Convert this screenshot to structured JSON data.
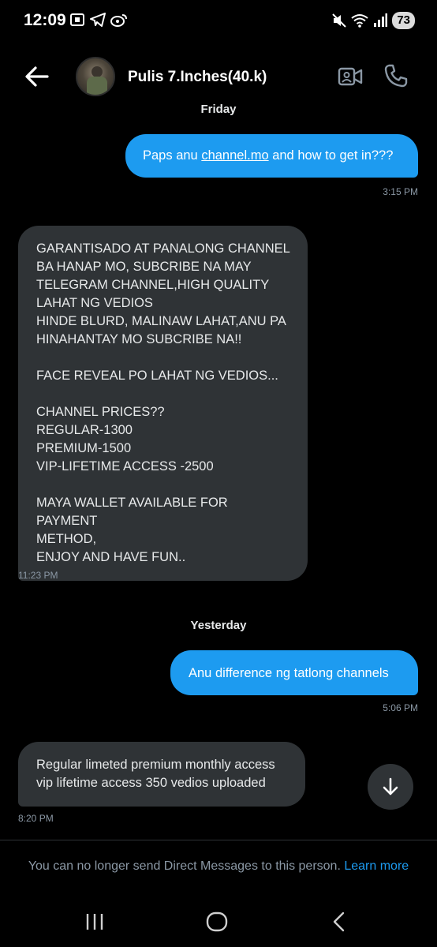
{
  "status_bar": {
    "time": "12:09",
    "battery": "73"
  },
  "header": {
    "contact_name": "Pulis 7.Inches(40.k)"
  },
  "chat": {
    "partial_date": "Friday",
    "msg1": {
      "before": "Paps anu ",
      "link": "channel.mo",
      "after": " and how to get in???",
      "time": "3:15 PM"
    },
    "msg2": {
      "text": "GARANTISADO AT PANALONG CHANNEL\nBA HANAP MO, SUBCRIBE NA MAY\nTELEGRAM CHANNEL,HIGH QUALITY\nLAHAT NG VEDIOS\nHINDE BLURD, MALINAW LAHAT,ANU PA\nHINAHANTAY MO SUBCRIBE NA!!\n\nFACE REVEAL PO LAHAT NG VEDIOS...\n\nCHANNEL PRICES??\nREGULAR-1300\nPREMIUM-1500\nVIP-LIFETIME ACCESS -2500\n\nMAYA WALLET AVAILABLE FOR PAYMENT\nMETHOD,\nENJOY AND HAVE FUN..",
      "time": "11:23 PM"
    },
    "date_yesterday": "Yesterday",
    "msg3": {
      "text": "Anu difference ng tatlong channels",
      "time": "5:06 PM"
    },
    "msg4": {
      "text": "Regular limeted premium monthly access\nvip lifetime access 350 vedios uploaded",
      "time": "8:20 PM"
    }
  },
  "footer": {
    "notice": "You can no longer send Direct Messages to this person.",
    "learn_more": "Learn more"
  },
  "colors": {
    "accent": "#1d9bf0",
    "incoming_bubble": "#2f3336",
    "background": "#000000",
    "muted": "#8b98a5"
  },
  "icons": [
    "back-arrow-icon",
    "video-call-icon",
    "phone-icon",
    "arrow-down-icon",
    "recents-icon",
    "home-icon",
    "nav-back-icon"
  ]
}
